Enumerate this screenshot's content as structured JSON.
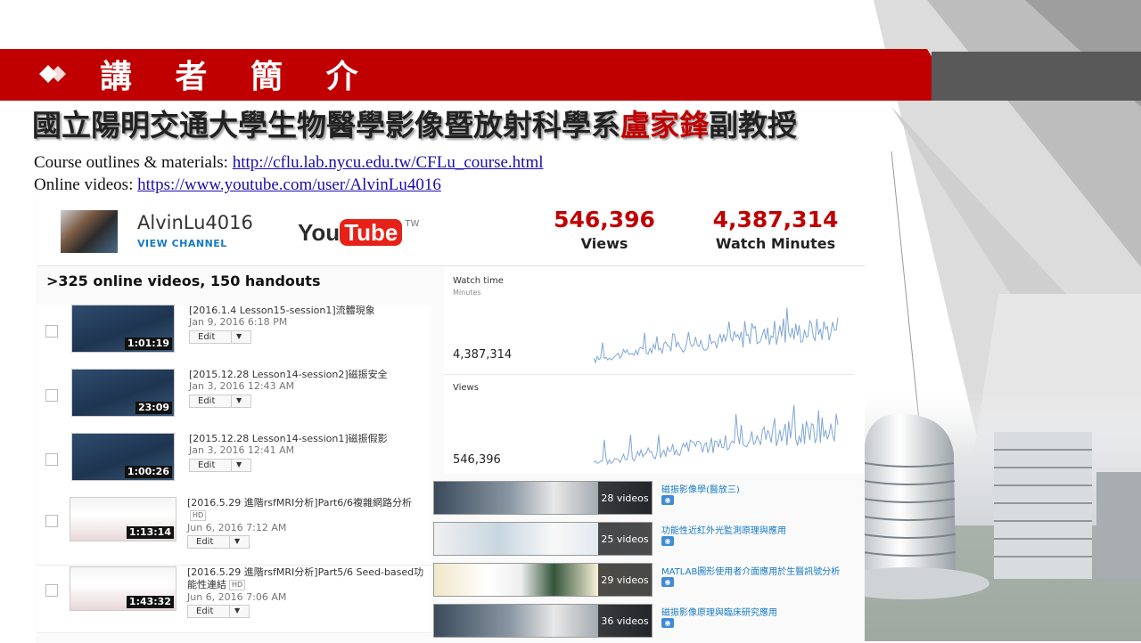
{
  "header": {
    "title": "講 者 簡 介",
    "affiliation_prefix": "國立陽明交通大學生物醫學影像暨放射科學系",
    "speaker_name": "盧家鋒",
    "speaker_title": "副教授"
  },
  "links": {
    "course_label": "Course outlines & materials:",
    "course_url": "http://cflu.lab.nycu.edu.tw/CFLu_course.html",
    "video_label": "Online videos:",
    "video_url": "https://www.youtube.com/user/AlvinLu4016"
  },
  "channel": {
    "name": "AlvinLu4016",
    "view_channel": "VIEW CHANNEL",
    "logo_you": "You",
    "logo_tube": "Tube",
    "logo_region": "TW",
    "views_value": "546,396",
    "views_label": "Views",
    "watch_value": "4,387,314",
    "watch_label": "Watch Minutes"
  },
  "videos": {
    "heading": ">325 online videos, 150 handouts",
    "edit_label": "Edit",
    "hd_label": "HD",
    "items": [
      {
        "title": "[2016.1.4 Lesson15-session1]流體現象",
        "date": "Jan 9, 2016 6:18 PM",
        "duration": "1:01:19"
      },
      {
        "title": "[2015.12.28 Lesson14-session2]磁振安全",
        "date": "Jan 3, 2016 12:43 AM",
        "duration": "23:09"
      },
      {
        "title": "[2015.12.28 Lesson14-session1]磁振假影",
        "date": "Jan 3, 2016 12:41 AM",
        "duration": "1:00:26"
      },
      {
        "title": "[2016.5.29 進階rsfMRI分析]Part6/6複雜網路分析",
        "date": "Jun 6, 2016 7:12 AM",
        "duration": "1:13:14"
      },
      {
        "title": "[2016.5.29 進階rsfMRI分析]Part5/6 Seed-based功能性連結",
        "date": "Jun 6, 2016 7:06 AM",
        "duration": "1:43:32"
      }
    ]
  },
  "charts": {
    "watch": {
      "label": "Watch time",
      "unit": "Minutes",
      "total": "4,387,314"
    },
    "views": {
      "label": "Views",
      "total": "546,396"
    }
  },
  "playlists": [
    {
      "count": "28 videos",
      "title": "磁振影像學(醫放三)"
    },
    {
      "count": "25 videos",
      "title": "功能性近紅外光監測原理與應用"
    },
    {
      "count": "29 videos",
      "title": "MATLAB圖形使用者介面應用於生醫訊號分析"
    },
    {
      "count": "36 videos",
      "title": "磁振影像原理與臨床研究應用"
    }
  ],
  "colors": {
    "header_red": "#c00000",
    "link_blue": "#1a0dab",
    "chart_blue": "#7fa6d6",
    "youtube_red": "#e62117"
  }
}
